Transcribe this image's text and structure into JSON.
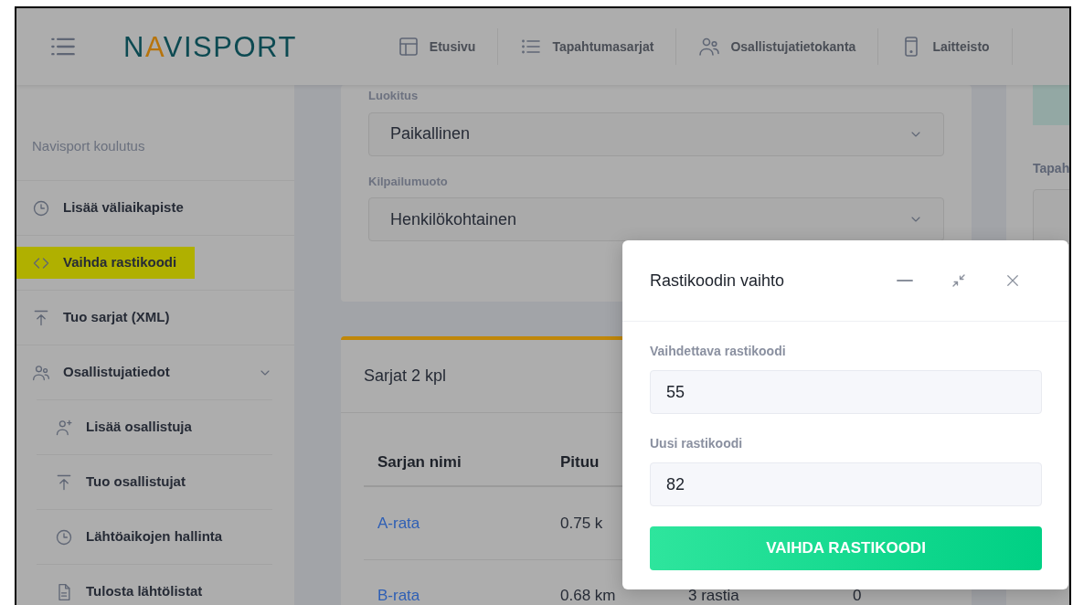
{
  "header": {
    "logo": "NAVISPORT",
    "nav": [
      {
        "label": "Etusivu"
      },
      {
        "label": "Tapahtumasarjat"
      },
      {
        "label": "Osallistujatietokanta"
      },
      {
        "label": "Laitteisto"
      }
    ]
  },
  "sidebar": {
    "title": "Navisport koulutus",
    "items": [
      {
        "label": "Lisää väliaikapiste",
        "highlighted": false
      },
      {
        "label": "Vaihda rastikoodi",
        "highlighted": true
      },
      {
        "label": "Tuo sarjat (XML)",
        "highlighted": false
      },
      {
        "label": "Osallistujatiedot",
        "highlighted": false,
        "expanded": true,
        "children": [
          {
            "label": "Lisää osallistuja",
            "highlighted": false
          },
          {
            "label": "Tuo osallistujat",
            "highlighted": false
          },
          {
            "label": "Lähtöaikojen hallinta",
            "highlighted": false
          },
          {
            "label": "Tulosta lähtölistat",
            "highlighted": false
          }
        ]
      }
    ]
  },
  "settings_form": {
    "fields": [
      {
        "label": "Luokitus",
        "value": "Paikallinen"
      },
      {
        "label": "Kilpailumuoto",
        "value": "Henkilökohtainen"
      }
    ]
  },
  "side_panel": {
    "label": "Tapah"
  },
  "series_card": {
    "title": "Sarjat 2 kpl",
    "columns": [
      "Sarjan nimi",
      "Pituu"
    ],
    "rows": [
      [
        "A-rata",
        "0.75 k"
      ],
      [
        "B-rata",
        "0.68 km",
        "3 rastia",
        "0"
      ]
    ]
  },
  "modal": {
    "title": "Rastikoodin vaihto",
    "fields": [
      {
        "label": "Vaihdettava rastikoodi",
        "value": "55"
      },
      {
        "label": "Uusi rastikoodi",
        "value": "82"
      }
    ],
    "button": "VAIHDA RASTIKOODI"
  }
}
